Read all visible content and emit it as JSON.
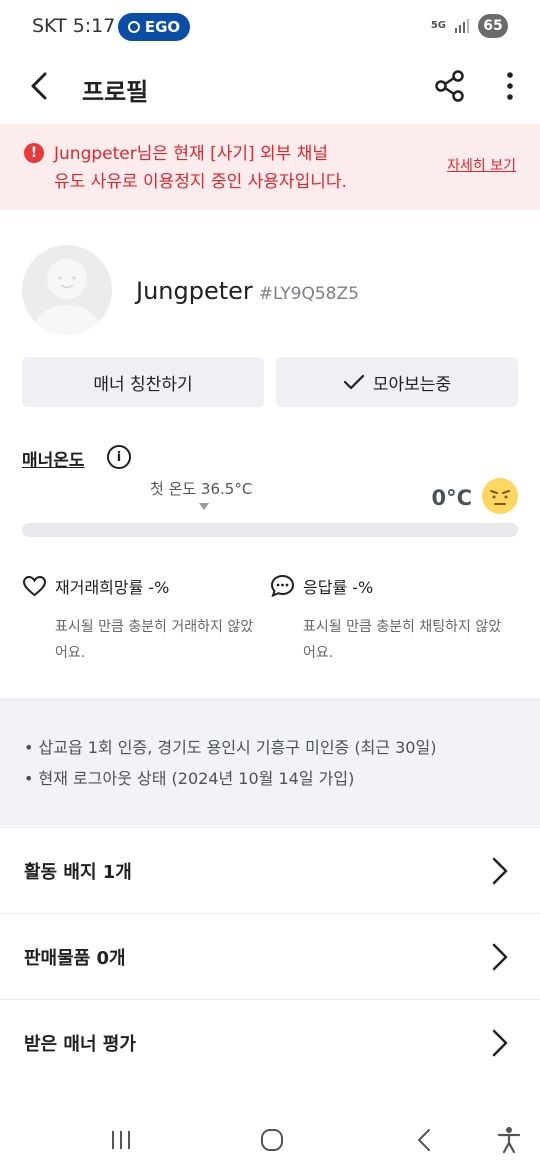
{
  "status_bar": {
    "carrier_time": "SKT 5:17",
    "badge": "EGO",
    "network": "5G",
    "battery": "65"
  },
  "app_bar": {
    "title": "프로필"
  },
  "warning": {
    "line1": "Jungpeter님은 현재 [사기] 외부 채널",
    "line2": "유도 사유로 이용정지 중인 사용자입니다.",
    "link": "자세히 보기"
  },
  "profile": {
    "nickname": "Jungpeter",
    "user_id": "#LY9Q58Z5"
  },
  "buttons": {
    "praise": "매너 칭찬하기",
    "watching": "모아보는중"
  },
  "manner_temp": {
    "label": "매너온도",
    "first_temp": "첫 온도 36.5°C",
    "current": "0°C"
  },
  "stats": {
    "rebuy": {
      "title": "재거래희망률 -%",
      "desc": "표시될 만큼 충분히 거래하지 않았어요."
    },
    "response": {
      "title": "응답률 -%",
      "desc": "표시될 만큼 충분히 채팅하지 않았어요."
    }
  },
  "info": {
    "line1": "• 삽교읍 1회 인증, 경기도 용인시 기흥구 미인증 (최근 30일)",
    "line2": "• 현재 로그아웃 상태 (2024년 10월 14일 가입)"
  },
  "menu": [
    "활동 배지 1개",
    "판매물품 0개",
    "받은 매너 평가"
  ],
  "colors": {
    "warning_red": "#e2262f",
    "warning_bg": "#fdecec",
    "badge_blue": "#0a4ea8"
  }
}
